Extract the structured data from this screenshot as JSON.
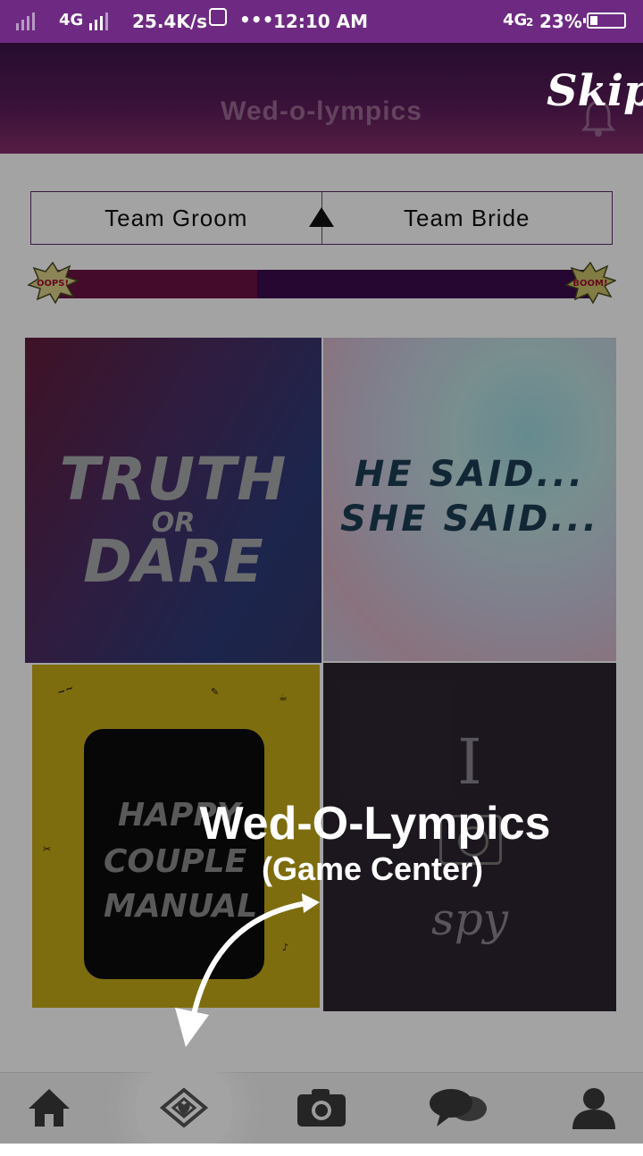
{
  "status_bar": {
    "network_1": "4G",
    "speed": "25.4K/s",
    "dots": "•••",
    "time": "12:10 AM",
    "network_2": "4G",
    "network_2_sub": "2",
    "battery": "23%",
    "battery_level": 0.23
  },
  "header": {
    "title": "Wed-o-lympics",
    "skip_label": "Skip"
  },
  "teams": {
    "groom_label": "Team Groom",
    "bride_label": "Team Bride"
  },
  "score_bar": {
    "groom_fraction": 0.38,
    "left_badge": "OOPS!",
    "right_badge": "BOOM!"
  },
  "games": [
    {
      "name": "truth-or-dare",
      "line1": "TRUTH",
      "line2": "OR",
      "line3": "DARE"
    },
    {
      "name": "he-said-she-said",
      "line1": "HE SAID...",
      "line2": "SHE SAID..."
    },
    {
      "name": "happy-couple-manual",
      "line1": "HAPPY",
      "line2": "COUPLE",
      "line3": "MANUAL"
    },
    {
      "name": "i-spy",
      "line1": "I",
      "line2": "spy"
    }
  ],
  "coachmark": {
    "title": "Wed-O-Lympics",
    "subtitle": "(Game Center)"
  },
  "nav": {
    "items": [
      {
        "icon": "home-icon"
      },
      {
        "icon": "game-center-icon"
      },
      {
        "icon": "camera-icon"
      },
      {
        "icon": "chat-icon"
      },
      {
        "icon": "profile-icon"
      }
    ]
  },
  "colors": {
    "status_bar": "#6e2a82",
    "groom": "#6b1242",
    "bride": "#3a0c4d"
  }
}
